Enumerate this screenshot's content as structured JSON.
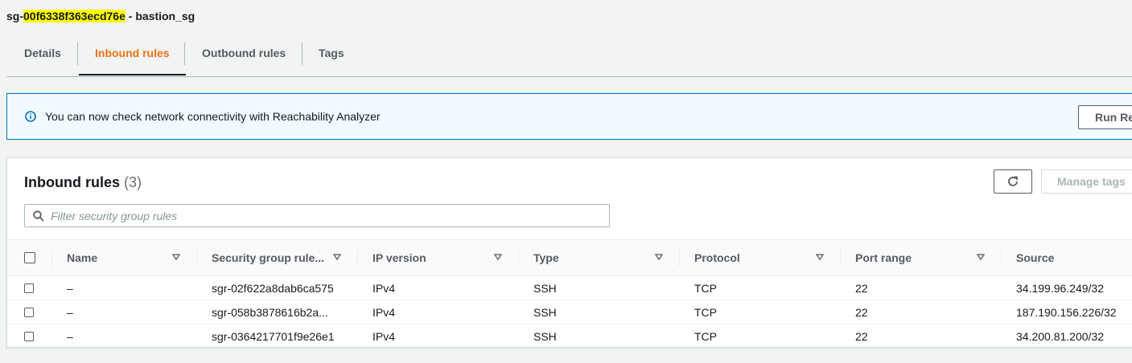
{
  "header": {
    "sg_prefix": "sg-",
    "sg_id_highlight": "00f6338f363ecd76e",
    "sg_suffix": " - bastion_sg"
  },
  "tabs": [
    {
      "label": "Details",
      "active": false
    },
    {
      "label": "Inbound rules",
      "active": true
    },
    {
      "label": "Outbound rules",
      "active": false
    },
    {
      "label": "Tags",
      "active": false
    }
  ],
  "banner": {
    "message": "You can now check network connectivity with Reachability Analyzer",
    "button_label": "Run Re",
    "icon": "info-icon"
  },
  "panel": {
    "title": "Inbound rules",
    "count": "(3)",
    "refresh_icon": "refresh-icon",
    "manage_tags_label": "Manage tags",
    "search_placeholder": "Filter security group rules"
  },
  "table": {
    "columns": [
      "Name",
      "Security group rule...",
      "IP version",
      "Type",
      "Protocol",
      "Port range",
      "Source"
    ],
    "rows": [
      {
        "name": "–",
        "rule_id": "sgr-02f622a8dab6ca575",
        "ip_version": "IPv4",
        "type": "SSH",
        "protocol": "TCP",
        "port_range": "22",
        "source": "34.199.96.249/32"
      },
      {
        "name": "–",
        "rule_id": "sgr-058b3878616b2a...",
        "ip_version": "IPv4",
        "type": "SSH",
        "protocol": "TCP",
        "port_range": "22",
        "source": "187.190.156.226/32"
      },
      {
        "name": "–",
        "rule_id": "sgr-0364217701f9e26e1",
        "ip_version": "IPv4",
        "type": "SSH",
        "protocol": "TCP",
        "port_range": "22",
        "source": "34.200.81.200/32"
      }
    ]
  },
  "colors": {
    "accent": "#ec7211",
    "info_border": "#0073bb",
    "highlight": "#ffff00"
  }
}
